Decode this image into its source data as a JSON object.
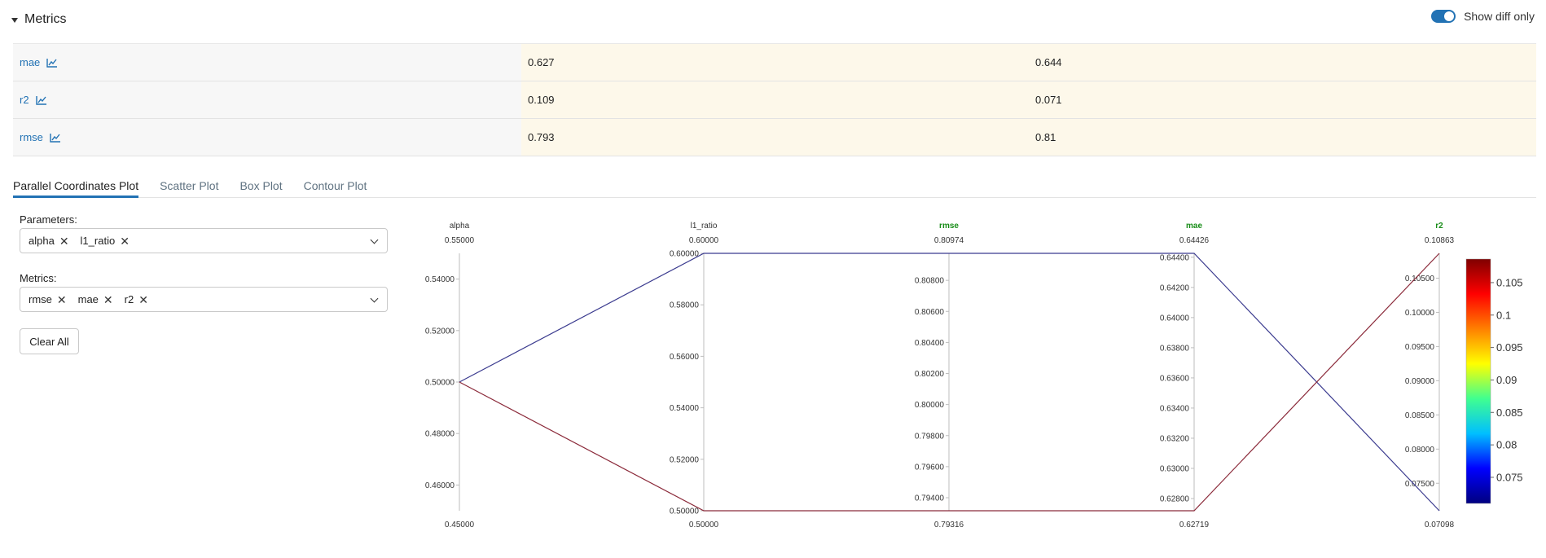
{
  "section": {
    "title": "Metrics"
  },
  "toggle": {
    "label": "Show diff only",
    "on": true
  },
  "metrics_rows": [
    {
      "name": "mae",
      "values": [
        "0.627",
        "0.644"
      ]
    },
    {
      "name": "r2",
      "values": [
        "0.109",
        "0.071"
      ]
    },
    {
      "name": "rmse",
      "values": [
        "0.793",
        "0.81"
      ]
    }
  ],
  "tabs": [
    "Parallel Coordinates Plot",
    "Scatter Plot",
    "Box Plot",
    "Contour Plot"
  ],
  "active_tab": 0,
  "params": {
    "label": "Parameters:",
    "chips": [
      "alpha",
      "l1_ratio"
    ]
  },
  "metrics_select": {
    "label": "Metrics:",
    "chips": [
      "rmse",
      "mae",
      "r2"
    ]
  },
  "clear_button": "Clear All",
  "colors": {
    "accent": "#2272b4",
    "metric_axis_title": "#188d18",
    "line_blue": "#3b3b8f",
    "line_red": "#8b2a3a"
  },
  "chart_data": {
    "type": "parallel_coordinates",
    "axes": [
      {
        "name": "alpha",
        "is_metric": false,
        "min": 0.45,
        "max": 0.55,
        "min_label": "0.45000",
        "max_label": "0.55000",
        "ticks": [
          0.46,
          0.48,
          0.5,
          0.52,
          0.54
        ],
        "tick_labels": [
          "0.46000",
          "0.48000",
          "0.50000",
          "0.52000",
          "0.54000"
        ],
        "tick_side": "left"
      },
      {
        "name": "l1_ratio",
        "is_metric": false,
        "min": 0.5,
        "max": 0.6,
        "min_label": "0.50000",
        "max_label": "0.60000",
        "ticks": [
          0.5,
          0.52,
          0.54,
          0.56,
          0.58,
          0.6
        ],
        "tick_labels": [
          "0.50000",
          "0.52000",
          "0.54000",
          "0.56000",
          "0.58000",
          "0.60000"
        ],
        "tick_side": "left"
      },
      {
        "name": "rmse",
        "is_metric": true,
        "min": 0.79316,
        "max": 0.80974,
        "min_label": "0.79316",
        "max_label": "0.80974",
        "ticks": [
          0.794,
          0.796,
          0.798,
          0.8,
          0.802,
          0.804,
          0.806,
          0.808
        ],
        "tick_labels": [
          "0.79400",
          "0.79600",
          "0.79800",
          "0.80000",
          "0.80200",
          "0.80400",
          "0.80600",
          "0.80800"
        ],
        "tick_side": "left"
      },
      {
        "name": "mae",
        "is_metric": true,
        "min": 0.62719,
        "max": 0.64426,
        "min_label": "0.62719",
        "max_label": "0.64426",
        "ticks": [
          0.628,
          0.63,
          0.632,
          0.634,
          0.636,
          0.638,
          0.64,
          0.642,
          0.644
        ],
        "tick_labels": [
          "0.62800",
          "0.63000",
          "0.63200",
          "0.63400",
          "0.63600",
          "0.63800",
          "0.64000",
          "0.64200",
          "0.64400"
        ],
        "tick_side": "left"
      },
      {
        "name": "r2",
        "is_metric": true,
        "min": 0.07098,
        "max": 0.10863,
        "min_label": "0.07098",
        "max_label": "0.10863",
        "ticks": [
          0.075,
          0.08,
          0.085,
          0.09,
          0.095,
          0.1,
          0.105
        ],
        "tick_labels": [
          "0.07500",
          "0.08000",
          "0.08500",
          "0.09000",
          "0.09500",
          "0.10000",
          "0.10500"
        ],
        "tick_side": "left"
      }
    ],
    "lines": [
      {
        "values": [
          0.5,
          0.6,
          0.80974,
          0.64426,
          0.07098
        ],
        "color": "#3b3b8f"
      },
      {
        "values": [
          0.5,
          0.5,
          0.79316,
          0.62719,
          0.10863
        ],
        "color": "#8b2a3a"
      }
    ],
    "colorbar": {
      "min": 0.07098,
      "max": 0.10863,
      "ticks": [
        0.075,
        0.08,
        0.085,
        0.09,
        0.095,
        0.1,
        0.105
      ],
      "tick_labels": [
        "0.075",
        "0.08",
        "0.085",
        "0.09",
        "0.095",
        "0.1",
        "0.105"
      ],
      "colorscale": [
        "#00007f",
        "#0000ff",
        "#00bfff",
        "#40ff90",
        "#ffff00",
        "#ff8000",
        "#ff0000",
        "#800000"
      ]
    }
  }
}
